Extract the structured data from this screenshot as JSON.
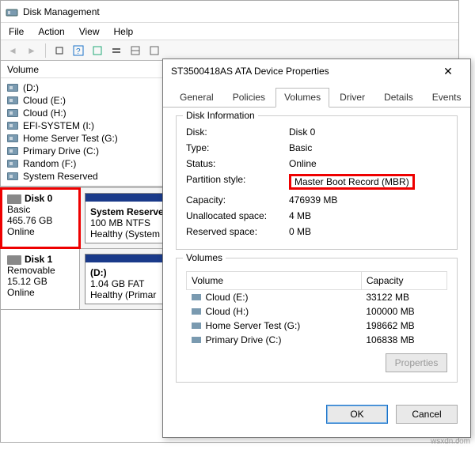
{
  "app": {
    "title": "Disk Management",
    "menus": [
      "File",
      "Action",
      "View",
      "Help"
    ]
  },
  "toolbar_icons": [
    "back",
    "forward",
    "up",
    "table",
    "help",
    "refresh",
    "list",
    "grid",
    "props"
  ],
  "volume_header": {
    "col1": "Volume"
  },
  "volumes": [
    "(D:)",
    "Cloud (E:)",
    "Cloud (H:)",
    "EFI-SYSTEM (I:)",
    "Home Server Test (G:)",
    "Primary Drive (C:)",
    "Random (F:)",
    "System Reserved"
  ],
  "disks": [
    {
      "name": "Disk 0",
      "type": "Basic",
      "size": "465.76 GB",
      "status": "Online",
      "highlight": true,
      "parts": [
        {
          "name": "System Reserved",
          "detail1": "100 MB NTFS",
          "detail2": "Healthy (System"
        }
      ]
    },
    {
      "name": "Disk 1",
      "type": "Removable",
      "size": "15.12 GB",
      "status": "Online",
      "highlight": false,
      "parts": [
        {
          "name": "(D:)",
          "detail1": "1.04 GB FAT",
          "detail2": "Healthy (Primar"
        }
      ]
    }
  ],
  "dialog": {
    "title": "ST3500418AS ATA Device Properties",
    "tabs": [
      "General",
      "Policies",
      "Volumes",
      "Driver",
      "Details",
      "Events"
    ],
    "active_tab": "Volumes",
    "disk_info_legend": "Disk Information",
    "disk_info": {
      "Disk": "Disk 0",
      "Type": "Basic",
      "Status": "Online",
      "Partition_style": "Master Boot Record (MBR)",
      "Capacity": "476939 MB",
      "Unallocated_space": "4 MB",
      "Reserved_space": "0 MB"
    },
    "labels": {
      "disk": "Disk:",
      "type": "Type:",
      "status": "Status:",
      "partition_style": "Partition style:",
      "capacity": "Capacity:",
      "unallocated": "Unallocated space:",
      "reserved": "Reserved space:"
    },
    "volumes_legend": "Volumes",
    "vol_table_head": {
      "volume": "Volume",
      "capacity": "Capacity"
    },
    "dlg_volumes": [
      {
        "name": "Cloud (E:)",
        "cap": "33122 MB"
      },
      {
        "name": "Cloud (H:)",
        "cap": "100000 MB"
      },
      {
        "name": "Home Server Test (G:)",
        "cap": "198662 MB"
      },
      {
        "name": "Primary Drive (C:)",
        "cap": "106838 MB"
      }
    ],
    "buttons": {
      "properties": "Properties",
      "ok": "OK",
      "cancel": "Cancel"
    }
  },
  "watermark": "wsxdn.com"
}
